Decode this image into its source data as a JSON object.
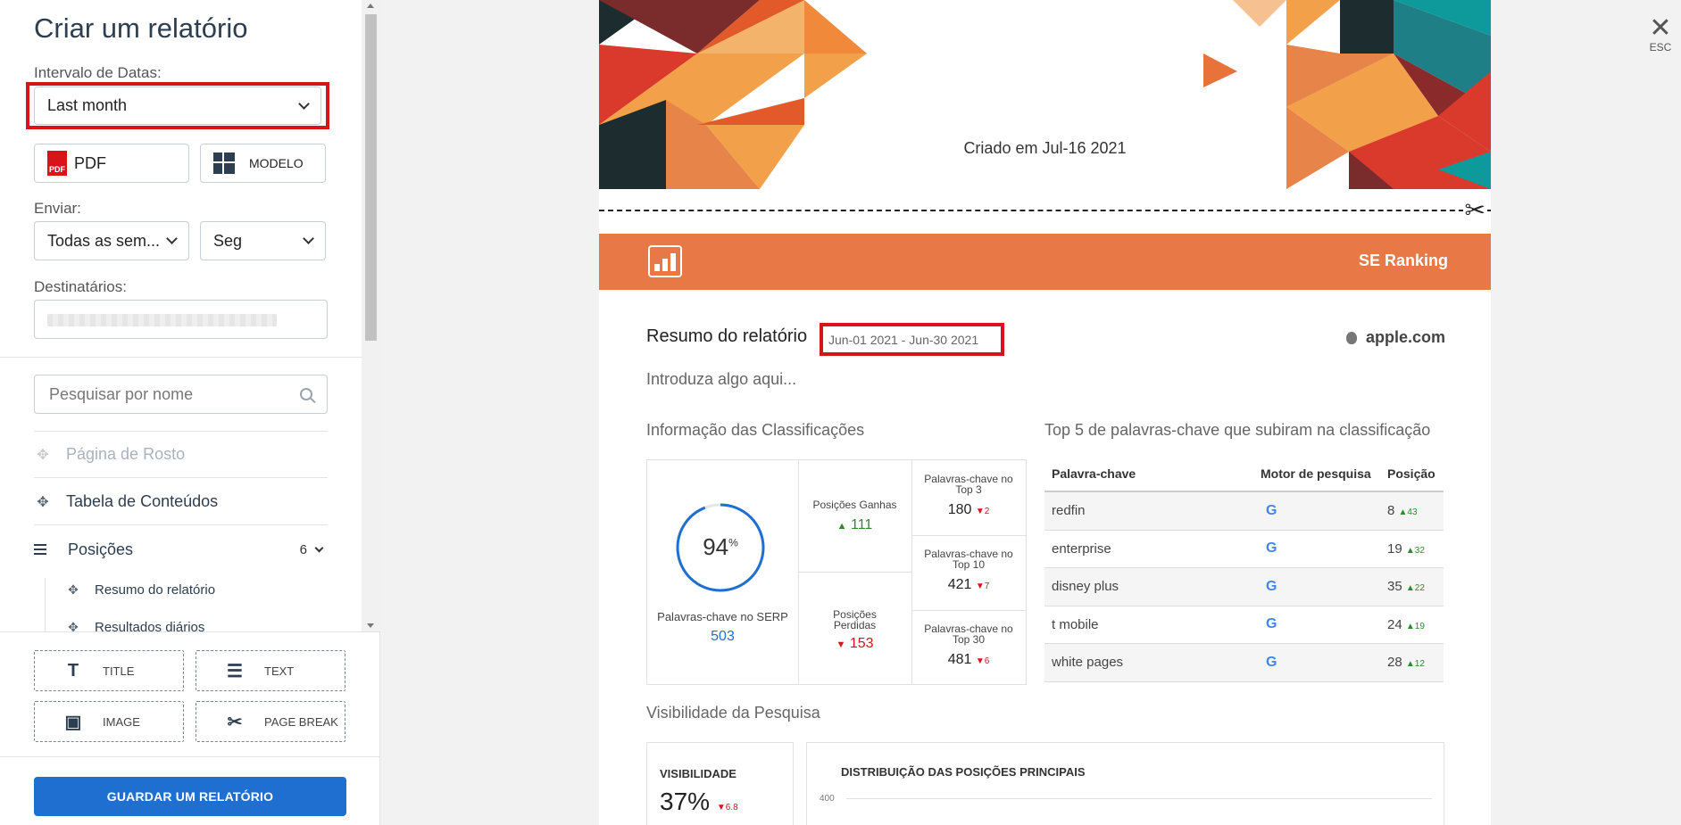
{
  "sidebar": {
    "title": "Criar um relatório",
    "date_range_label": "Intervalo de Datas:",
    "date_range_value": "Last month",
    "format_value": "PDF",
    "pdf_icon_text": "PDF",
    "template_label": "MODELO",
    "send_label": "Enviar:",
    "send_frequency": "Todas as sem...",
    "send_day": "Seg",
    "recipients_label": "Destinatários:",
    "search_placeholder": "Pesquisar por nome",
    "sections": [
      {
        "label": "Página de Rosto"
      },
      {
        "label": "Tabela de Conteúdos"
      },
      {
        "label": "Posições",
        "count": "6"
      }
    ],
    "sub_sections": [
      {
        "label": "Resumo do relatório"
      },
      {
        "label": "Resultados diários"
      }
    ],
    "elements": {
      "title": "TITLE",
      "text": "TEXT",
      "image": "IMAGE",
      "page_break": "PAGE BREAK"
    },
    "save_button": "GUARDAR UM RELATÓRIO"
  },
  "close": {
    "esc_label": "ESC"
  },
  "report": {
    "cover_created": "Criado em Jul-16 2021",
    "brand": "SE Ranking",
    "summary_title": "Resumo do relatório",
    "date_range": "Jun-01 2021 - Jun-30 2021",
    "domain": "apple.com",
    "intro_placeholder": "Introduza algo aqui...",
    "rankings_heading": "Informação das Classificações",
    "top_keywords_heading": "Top 5 de palavras-chave que subiram na classificação",
    "rankings": {
      "serp_percent": "94",
      "serp_percent_value": 94,
      "serp_percent_sign": "%",
      "serp_label": "Palavras-chave no SERP",
      "serp_count": "503",
      "gained_label": "Posições Ganhas",
      "gained_value": "111",
      "lost_label_1": "Posições",
      "lost_label_2": "Perdidas",
      "lost_value": "153",
      "top3_label_1": "Palavras-chave no",
      "top3_label_2": "Top 3",
      "top3_value": "180",
      "top3_delta": "2",
      "top10_label_1": "Palavras-chave no",
      "top10_label_2": "Top 10",
      "top10_value": "421",
      "top10_delta": "7",
      "top30_label_1": "Palavras-chave no",
      "top30_label_2": "Top 30",
      "top30_value": "481",
      "top30_delta": "6"
    },
    "keywords_table": {
      "headers": [
        "Palavra-chave",
        "Motor de pesquisa",
        "Posição"
      ],
      "rows": [
        {
          "keyword": "redfin",
          "engine": "G",
          "position": "8",
          "delta": "43"
        },
        {
          "keyword": "enterprise",
          "engine": "G",
          "position": "19",
          "delta": "32"
        },
        {
          "keyword": "disney plus",
          "engine": "G",
          "position": "35",
          "delta": "22"
        },
        {
          "keyword": "t mobile",
          "engine": "G",
          "position": "24",
          "delta": "19"
        },
        {
          "keyword": "white pages",
          "engine": "G",
          "position": "28",
          "delta": "12"
        }
      ]
    },
    "visibility_heading": "Visibilidade da Pesquisa",
    "visibility_label": "VISIBILIDADE",
    "visibility_value": "37%",
    "visibility_delta": "6.8",
    "distribution_label": "DISTRIBUIÇÃO DAS POSIÇÕES PRINCIPAIS",
    "distribution_tick": "400"
  },
  "colors": {
    "accent_orange": "#e87845",
    "highlight_red": "#d7141a",
    "primary_blue": "#1f6fd1",
    "positive_green": "#2d8a2d"
  }
}
